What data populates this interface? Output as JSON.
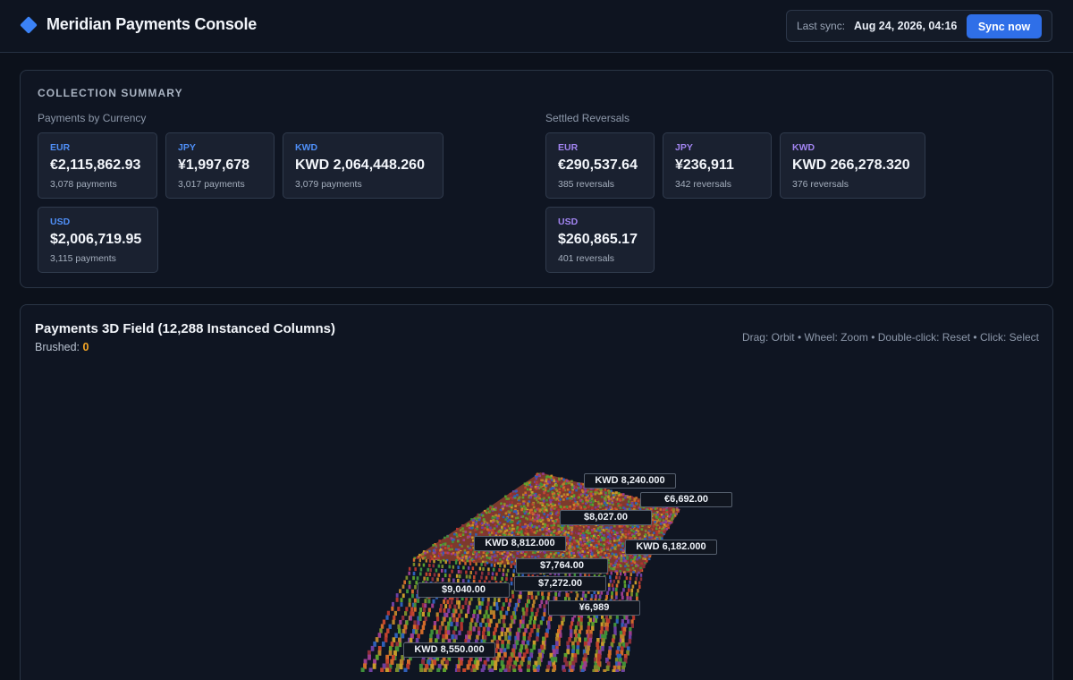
{
  "header": {
    "title": "Meridian Payments Console",
    "sync_label": "Last sync:",
    "sync_time": "Aug 24, 2026, 04:16",
    "sync_button": "Sync now"
  },
  "colors": {
    "accent": "#3b82f6",
    "brushed": "#f5a524",
    "currency_blue": "#4f8ff7",
    "currency_purple": "#a184f0"
  },
  "summary": {
    "title": "COLLECTION SUMMARY",
    "payments": {
      "label": "Payments by Currency",
      "cards": [
        {
          "currency": "EUR",
          "amount": "€2,115,862.93",
          "count": "3,078 payments"
        },
        {
          "currency": "JPY",
          "amount": "¥1,997,678",
          "count": "3,017 payments"
        },
        {
          "currency": "KWD",
          "amount": "KWD 2,064,448.260",
          "count": "3,079 payments"
        },
        {
          "currency": "USD",
          "amount": "$2,006,719.95",
          "count": "3,115 payments"
        }
      ]
    },
    "reversals": {
      "label": "Settled Reversals",
      "cards": [
        {
          "currency": "EUR",
          "amount": "€290,537.64",
          "count": "385 reversals"
        },
        {
          "currency": "JPY",
          "amount": "¥236,911",
          "count": "342 reversals"
        },
        {
          "currency": "KWD",
          "amount": "KWD 266,278.320",
          "count": "376 reversals"
        },
        {
          "currency": "USD",
          "amount": "$260,865.17",
          "count": "401 reversals"
        }
      ]
    }
  },
  "field": {
    "title": "Payments 3D Field (12,288 Instanced Columns)",
    "brushed_label": "Brushed:",
    "brushed_value": "0",
    "hint": "Drag: Orbit • Wheel: Zoom • Double-click: Reset • Click: Select",
    "labels": [
      "KWD 8,240.000",
      "€6,692.00",
      "$8,027.00",
      "KWD 8,812.000",
      "KWD 6,182.000",
      "$7,764.00",
      "$9,040.00",
      "$7,272.00",
      "¥6,989",
      "KWD 8,550.000"
    ]
  }
}
